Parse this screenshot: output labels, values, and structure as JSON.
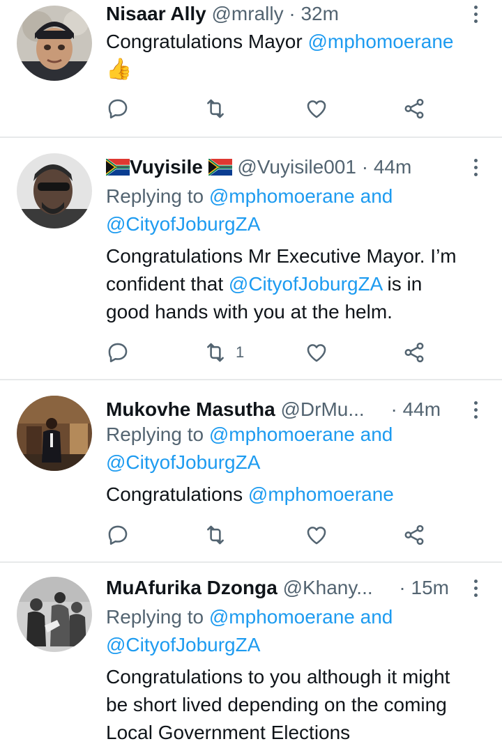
{
  "tweets": [
    {
      "name": "Nisaar Ally",
      "handle": "@mrally",
      "time": "32m",
      "body_text": "Congratulations Mayor ",
      "body_mention": "@mphomoerane",
      "emoji": "👍",
      "retweet_count": "",
      "avatar_icon": "user-avatar-photo"
    },
    {
      "name": "Vuyisile",
      "handle": "@Vuyisile001",
      "time": "44m",
      "replying_prefix": "Replying to",
      "replying_mention1": "@mphomoerane",
      "replying_and": "and",
      "replying_mention2": "@CityofJoburgZA",
      "body_line1": "Congratulations Mr Executive Mayor. I’m",
      "body_line2_a": "confident that ",
      "body_line2_mention": "@CityofJoburgZA",
      "body_line2_b": " is in",
      "body_line3": "good hands with you at the helm.",
      "retweet_count": "1",
      "flag_icon": "south-africa-flag-icon"
    },
    {
      "name": "Mukovhe Masutha",
      "handle": "@DrMu...",
      "time": "44m",
      "replying_prefix": "Replying to",
      "replying_mention1": "@mphomoerane",
      "replying_and": "and",
      "replying_mention2": "@CityofJoburgZA",
      "body_text": "Congratulations ",
      "body_mention": "@mphomoerane",
      "retweet_count": ""
    },
    {
      "name": "MuAfurika Dzonga",
      "handle": "@Khany...",
      "time": "15m",
      "replying_prefix": "Replying to",
      "replying_mention1": "@mphomoerane",
      "replying_and": "and",
      "replying_mention2": "@CityofJoburgZA",
      "body_line1": "Congratulations to you although it might",
      "body_line2": "be short lived depending on the coming",
      "body_line3": "Local Government Elections"
    }
  ],
  "separator": "·",
  "colors": {
    "accent": "#1d9bf0",
    "secondary_text": "#536471",
    "primary_text": "#0f1419",
    "divider": "#e7e9ea"
  }
}
